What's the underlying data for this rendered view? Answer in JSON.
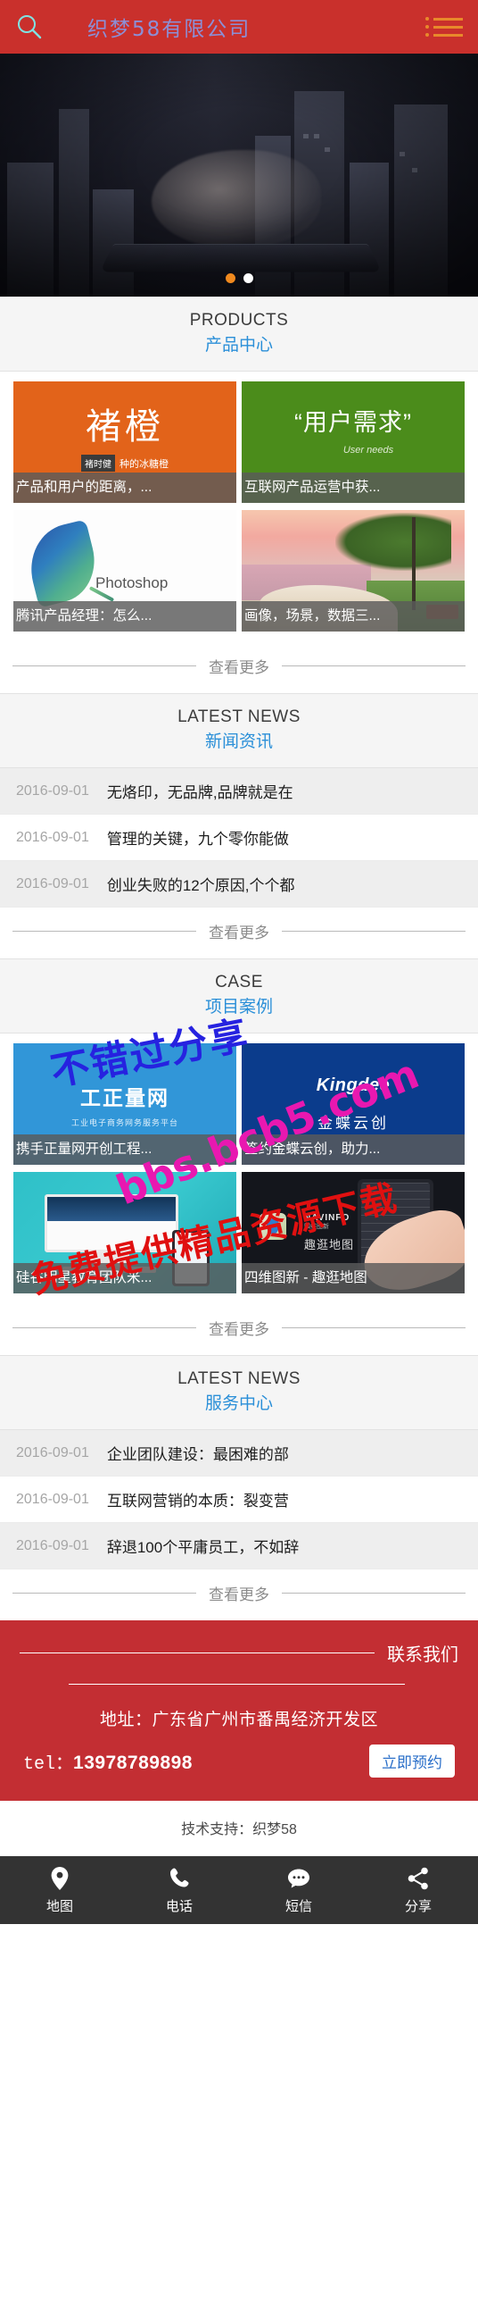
{
  "header": {
    "title": "织梦58有限公司",
    "search_icon": "search-icon",
    "menu_icon": "hamburger-menu-icon"
  },
  "banner": {
    "dots": [
      "active",
      "inactive"
    ]
  },
  "sections": {
    "products": {
      "en": "PRODUCTS",
      "cn": "产品中心"
    },
    "news": {
      "en": "LATEST NEWS",
      "cn": "新闻资讯"
    },
    "case": {
      "en": "CASE",
      "cn": "项目案例"
    },
    "service": {
      "en": "LATEST NEWS",
      "cn": "服务中心"
    }
  },
  "more_label": "查看更多",
  "products": [
    {
      "caption": "产品和用户的距离，...",
      "big": "褚橙",
      "tag": "褚时健",
      "small": "种的冰糖橙"
    },
    {
      "caption": "互联网产品运营中获...",
      "big": "“用户需求”",
      "small": "User needs"
    },
    {
      "caption": "腾讯产品经理：怎么...",
      "label": "Photoshop"
    },
    {
      "caption": "画像，场景，数据三..."
    }
  ],
  "cases": [
    {
      "caption": "携手正量网开创工程...",
      "logo": "工正量网",
      "sub": "工业电子商务网务服务平台"
    },
    {
      "caption": "签约金蝶云创，助力...",
      "logo": "Kingdee",
      "sub": "金蝶云创"
    },
    {
      "caption": "硅谷明星教育团队米..."
    },
    {
      "caption": "四维图新 - 趣逛地图",
      "brand": "NAVINFO",
      "brand2": "四维图新",
      "brand3": "趣逛地图"
    }
  ],
  "news_items": [
    {
      "date": "2016-09-01",
      "title": "无烙印，无品牌,品牌就是在"
    },
    {
      "date": "2016-09-01",
      "title": "管理的关键，九个零你能做"
    },
    {
      "date": "2016-09-01",
      "title": "创业失败的12个原因,个个都"
    }
  ],
  "service_items": [
    {
      "date": "2016-09-01",
      "title": "企业团队建设：最困难的部"
    },
    {
      "date": "2016-09-01",
      "title": "互联网营销的本质：裂变营"
    },
    {
      "date": "2016-09-01",
      "title": "辞退100个平庸员工，不如辞"
    }
  ],
  "contact": {
    "title": "联系我们",
    "address": "地址：广东省广州市番禺经济开发区",
    "tel_label": "tel：",
    "tel_number": "13978789898",
    "book_button": "立即预约"
  },
  "support": "技术支持：织梦58",
  "bottom_nav": [
    {
      "label": "地图",
      "icon": "map-pin-icon"
    },
    {
      "label": "电话",
      "icon": "phone-icon"
    },
    {
      "label": "短信",
      "icon": "message-icon"
    },
    {
      "label": "分享",
      "icon": "share-icon"
    }
  ],
  "watermarks": {
    "wm1": "不错过分享",
    "wm2": "bbs.bcb5.com",
    "wm3": "免费提供精品资源下载"
  },
  "colors": {
    "brand_red": "#c32e33",
    "accent_blue": "#2a8fd8",
    "accent_orange": "#f0891e",
    "nav_dark": "#333333"
  }
}
